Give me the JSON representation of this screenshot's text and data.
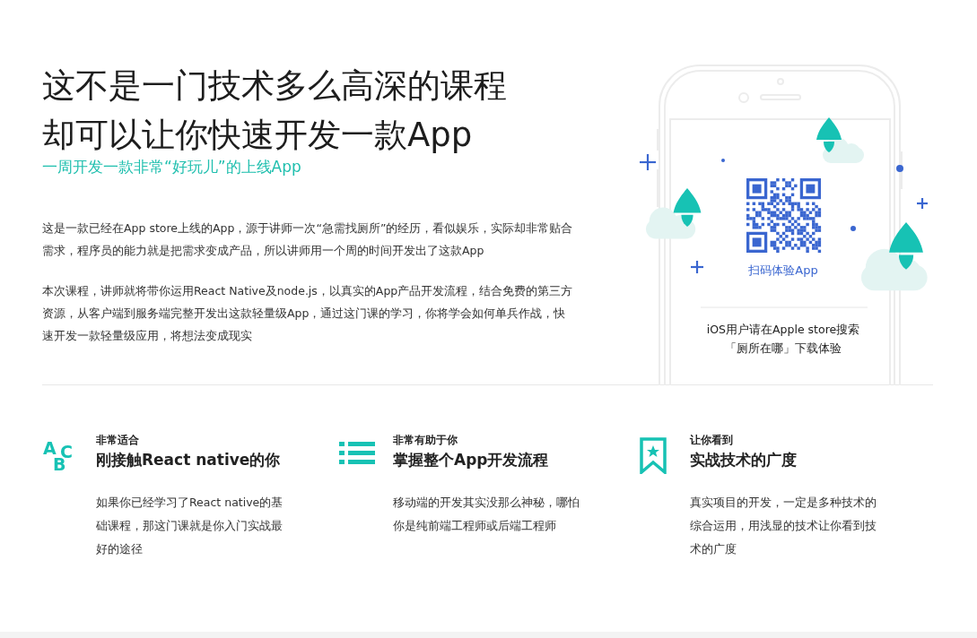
{
  "hero": {
    "title_lines": [
      "这不是一门技术多么高深的课程",
      "却可以让你快速开发一款App"
    ],
    "subtitle": "一周开发一款非常“好玩儿”的上线App",
    "paragraphs": [
      "这是一款已经在App store上线的App，源于讲师一次“急需找厕所”的经历，看似娱乐，实际却非常贴合需求，程序员的能力就是把需求变成产品，所以讲师用一个周的时间开发出了这款App",
      "本次课程，讲师就将带你运用React Native及node.js，以真实的App产品开发流程，结合免费的第三方资源，从客户端到服务端完整开发出这款轻量级App，通过这门课的学习，你将学会如何单兵作战，快速开发一款轻量级应用，将想法变成现实"
    ]
  },
  "phone": {
    "scan_label": "扫码体验App",
    "ios_lines": [
      "iOS用户请在Apple store搜索",
      "「厕所在哪」下载体验"
    ]
  },
  "features": [
    {
      "kind": "letters",
      "glyphs": [
        "A",
        "B",
        "C"
      ],
      "eyebrow": "非常适合",
      "title": "刚接触React native的你",
      "description": "如果你已经学习了React native的基础课程，那这门课就是你入门实战最好的途径"
    },
    {
      "kind": "list",
      "eyebrow": "非常有助于你",
      "title": "掌握整个App开发流程",
      "description": "移动端的开发其实没那么神秘，哪怕你是纯前端工程师或后端工程师"
    },
    {
      "kind": "bookmark",
      "eyebrow": "让你看到",
      "title": "实战技术的广度",
      "description": "真实项目的开发，一定是多种技术的综合运用，用浅显的技术让你看到技术的广度"
    }
  ]
}
